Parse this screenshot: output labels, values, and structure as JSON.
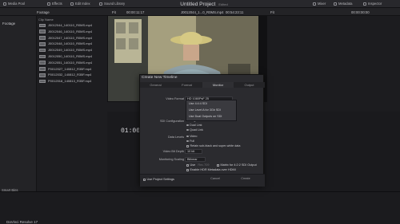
{
  "topbar": {
    "media_pool": "Media Pool",
    "effects": "Effects",
    "edit_index": "Edit Index",
    "sound_library": "Sound Library",
    "title": "Untitled Project",
    "title_sub": "Edited",
    "mixer": "Mixer",
    "metadata": "Metadata",
    "inspector": "Inspector"
  },
  "toolbar2": {
    "bin_name": "Footage",
    "zoom": "Fit",
    "src_tc": "00:00:11:17",
    "clip_name": "J0012044_1...0_R0MS.mp4",
    "dur_tc": "00:54:23:11",
    "zoom2": "Fit",
    "rec_tc": "00:00:00:00"
  },
  "bins": {
    "footage": "Footage",
    "smart_bins": "Smart Bins",
    "keywords": "Keywords"
  },
  "media": {
    "header": "Clip Name",
    "clips": [
      "J0012044_140110_R0MS.mp4",
      "J0012046_140110_R0MS.mp4",
      "J0012047_140110_R0MS.mp4",
      "J0012048_140110_R0MS.mp4",
      "J0012049_140110_R0MS.mp4",
      "J0012050_140110_R0MS.mp4",
      "J0012051_140110_R0MS.mp4",
      "P0012027_140812_R35F.mp4",
      "P0012032_140812_R35F.mp4",
      "P0012018_140813_R35F.mp4"
    ]
  },
  "timeline": {
    "timecode": "01:00:"
  },
  "bottombar": {
    "app_name": "DaVinci Resolve 17"
  },
  "dialog": {
    "title": "Create New Timeline",
    "tabs": [
      "General",
      "Format",
      "Monitor",
      "Output"
    ],
    "active_tab": "Monitor",
    "video_format_label": "Video Format",
    "video_format_value": "HD 1080PsF 25",
    "sdi_config_label": "SDI Configuration",
    "data_levels_label": "Data Levels",
    "bit_depth_label": "Video Bit Depth",
    "bit_depth_value": "10 bit",
    "scaling_label": "Monitoring Scaling",
    "scaling_value": "Bilinear",
    "dropdown_items": [
      "Use 4:4:4 SDI",
      "Use Level A for 3Gb SDI",
      "Use Dual Outputs on SDI"
    ],
    "sdi_options": [
      "Single Link",
      "Dual Link",
      "Quad Link"
    ],
    "data_level_options": [
      "Video",
      "Full"
    ],
    "retain_subblack": "Retain sub-black and super-white data",
    "use_label": "Use",
    "use_value": "Rec.709",
    "matrix_label": "Matrix for 4:2:2 SDI Output",
    "hdr_label": "Enable HDR Metadata over HDMI",
    "use_project_settings": "Use Project Settings",
    "cancel": "Cancel",
    "create": "Create"
  }
}
